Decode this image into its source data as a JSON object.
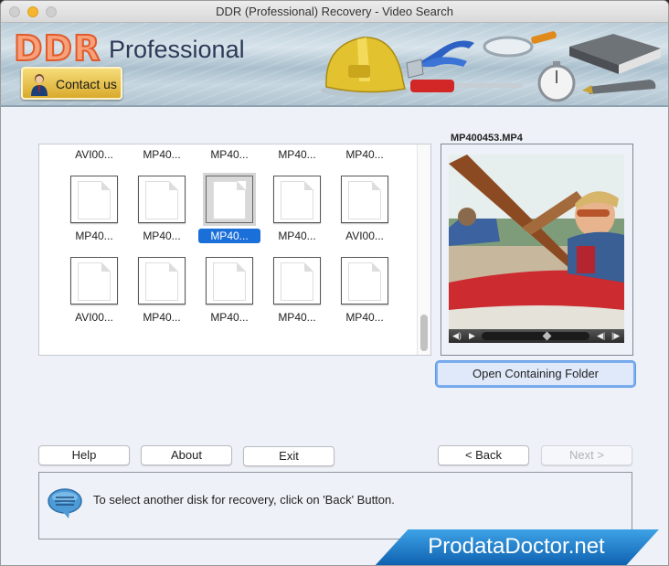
{
  "window": {
    "title": "DDR (Professional) Recovery - Video Search"
  },
  "banner": {
    "logo_ddr": "DDR",
    "logo_professional": "Professional",
    "contact_label": "Contact us",
    "icons": [
      "hard-hat-icon",
      "pliers-icon",
      "magnifier-icon",
      "book-icon",
      "screwdriver-icon",
      "stopwatch-icon",
      "pen-icon"
    ]
  },
  "file_grid": {
    "rows": [
      [
        "AVI00...",
        "MP40...",
        "MP40...",
        "MP40...",
        "MP40..."
      ],
      [
        "MP40...",
        "MP40...",
        "MP40...",
        "MP40...",
        "AVI00..."
      ],
      [
        "AVI00...",
        "MP40...",
        "MP40...",
        "MP40...",
        "MP40..."
      ]
    ],
    "selected": {
      "row": 1,
      "col": 2
    }
  },
  "preview": {
    "title": "MP400453.MP4",
    "playback_position": 0.6,
    "open_folder_label": "Open Containing Folder"
  },
  "buttons": {
    "help": "Help",
    "about": "About",
    "exit": "Exit",
    "back": "< Back",
    "next": "Next >"
  },
  "status": {
    "message": "To select another disk for recovery, click on 'Back' Button."
  },
  "brand": {
    "text": "ProdataDoctor.net"
  }
}
